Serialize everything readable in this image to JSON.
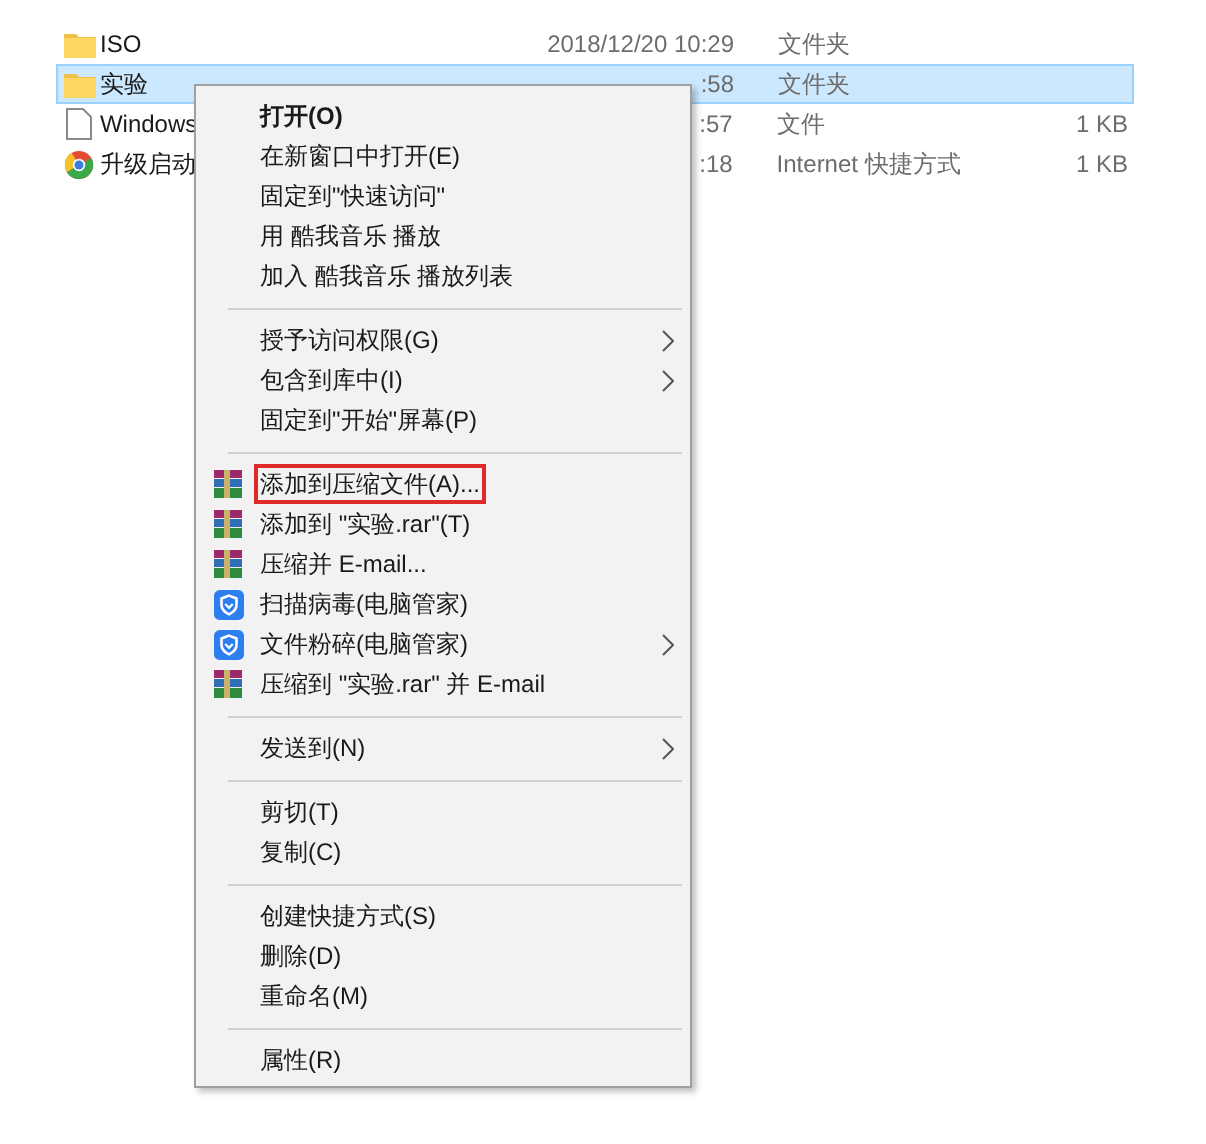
{
  "files": [
    {
      "kind": "folder",
      "name": "ISO",
      "date": "2018/12/20 10:29",
      "type": "文件夹",
      "selected": false
    },
    {
      "kind": "folder",
      "name": "实验",
      "date": ":58",
      "type": "文件夹",
      "selected": true
    },
    {
      "kind": "file",
      "name": "Windows",
      "date": ":57",
      "type": "文件",
      "size": "1 KB",
      "selected": false
    },
    {
      "kind": "shortcut",
      "name": "升级启动",
      "date": ":18",
      "type": "Internet 快捷方式",
      "size": "1 KB",
      "selected": false
    }
  ],
  "context_menu": [
    {
      "kind": "item",
      "label": "打开(O)",
      "default": true,
      "submenu": false,
      "outlined": false
    },
    {
      "kind": "item",
      "label": "在新窗口中打开(E)",
      "default": false,
      "submenu": false,
      "outlined": false
    },
    {
      "kind": "item",
      "label": "固定到\"快速访问\"",
      "default": false,
      "submenu": false,
      "outlined": false
    },
    {
      "kind": "item",
      "label": "用 酷我音乐 播放",
      "default": false,
      "submenu": false,
      "outlined": false
    },
    {
      "kind": "item",
      "label": "加入 酷我音乐 播放列表",
      "default": false,
      "submenu": false,
      "outlined": false
    },
    {
      "kind": "separator"
    },
    {
      "kind": "item",
      "label": "授予访问权限(G)",
      "default": false,
      "submenu": true,
      "outlined": false
    },
    {
      "kind": "item",
      "label": "包含到库中(I)",
      "default": false,
      "submenu": true,
      "outlined": false
    },
    {
      "kind": "item",
      "label": "固定到\"开始\"屏幕(P)",
      "default": false,
      "submenu": false,
      "outlined": false
    },
    {
      "kind": "separator"
    },
    {
      "kind": "archive",
      "label": "添加到压缩文件(A)...",
      "default": false,
      "submenu": false,
      "outlined": true
    },
    {
      "kind": "archive",
      "label": "添加到 \"实验.rar\"(T)",
      "default": false,
      "submenu": false,
      "outlined": false
    },
    {
      "kind": "archive",
      "label": "压缩并 E-mail...",
      "default": false,
      "submenu": false,
      "outlined": false
    },
    {
      "kind": "shield",
      "label": "扫描病毒(电脑管家)",
      "default": false,
      "submenu": false,
      "outlined": false
    },
    {
      "kind": "shield",
      "label": "文件粉碎(电脑管家)",
      "default": false,
      "submenu": true,
      "outlined": false
    },
    {
      "kind": "archive",
      "label": "压缩到 \"实验.rar\" 并 E-mail",
      "default": false,
      "submenu": false,
      "outlined": false
    },
    {
      "kind": "separator"
    },
    {
      "kind": "item",
      "label": "发送到(N)",
      "default": false,
      "submenu": true,
      "outlined": false
    },
    {
      "kind": "separator"
    },
    {
      "kind": "item",
      "label": "剪切(T)",
      "default": false,
      "submenu": false,
      "outlined": false
    },
    {
      "kind": "item",
      "label": "复制(C)",
      "default": false,
      "submenu": false,
      "outlined": false
    },
    {
      "kind": "separator"
    },
    {
      "kind": "item",
      "label": "创建快捷方式(S)",
      "default": false,
      "submenu": false,
      "outlined": false
    },
    {
      "kind": "item",
      "label": "删除(D)",
      "default": false,
      "submenu": false,
      "outlined": false
    },
    {
      "kind": "item",
      "label": "重命名(M)",
      "default": false,
      "submenu": false,
      "outlined": false
    },
    {
      "kind": "separator"
    },
    {
      "kind": "item",
      "label": "属性(R)",
      "default": false,
      "submenu": false,
      "outlined": false
    }
  ]
}
